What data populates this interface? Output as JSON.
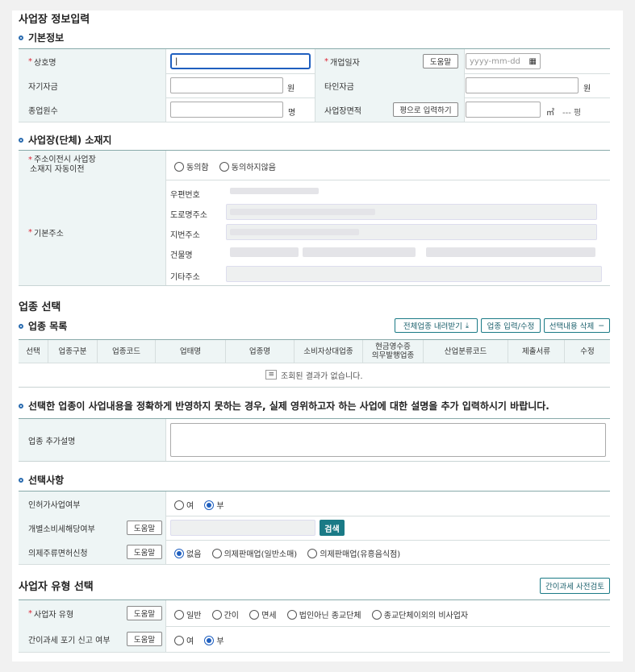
{
  "page_title": "사업장 정보입력",
  "basic": {
    "title": "기본정보",
    "trade_name": "상호명",
    "open_date": "개업일자",
    "help": "도움말",
    "date_placeholder": "yyyy-mm-dd",
    "own_capital": "자기자금",
    "other_capital": "타인자금",
    "won": "원",
    "employees": "종업원수",
    "person_unit": "명",
    "area": "사업장면적",
    "pyeong_input_btn": "평으로 입력하기",
    "m2": "㎡",
    "pyeong_value": "--- 평"
  },
  "location": {
    "title": "사업장(단체) 소재지",
    "auto_move_label_1": "주소이전시 사업장",
    "auto_move_label_2": "소재지 자동이전",
    "agree": "동의함",
    "disagree": "동의하지않음",
    "basic_address": "기본주소",
    "postal": "우편번호",
    "road": "도로명주소",
    "jibun": "지번주소",
    "building": "건물명",
    "other": "기타주소"
  },
  "industry": {
    "section_title": "업종 선택",
    "list_title": "업종 목록",
    "download_btn": "전체업종 내려받기",
    "edit_btn": "업종 입력/수정",
    "delete_btn": "선택내용 삭제",
    "columns": [
      "선택",
      "업종구분",
      "업종코드",
      "업태명",
      "업종명",
      "소비자상대업종",
      "현금영수증\n의무발행업종",
      "산업분류코드",
      "제출서류",
      "수정"
    ],
    "empty": "조회된 결과가 없습니다."
  },
  "extra": {
    "notice": "선택한 업종이 사업내용을 정확하게 반영하지 못하는 경우, 실제 영위하고자 하는 사업에 대한 설명을 추가 입력하시기 바랍니다.",
    "label": "업종 추가설명"
  },
  "options": {
    "title": "선택사항",
    "license": "인허가사업여부",
    "yes": "여",
    "no": "부",
    "excise": "개별소비세해당여부",
    "help": "도움말",
    "search_btn": "검색",
    "liquor": "의제주류면허신청",
    "liquor_opts": [
      "없음",
      "의제판매업(일반소매)",
      "의제판매업(유흥음식점)"
    ]
  },
  "biztype": {
    "title": "사업자 유형 선택",
    "pre_check_btn": "간이과세 사전검토",
    "type_label": "사업자 유형",
    "help": "도움말",
    "types": [
      "일반",
      "간이",
      "면세",
      "법인아닌 종교단체",
      "종교단체이외의 비사업자"
    ],
    "simple_giveup": "간이과세 포기 신고 여부",
    "yes": "여",
    "no": "부"
  },
  "colors": {
    "accent": "#2b6cb0",
    "label_bg": "#eef5f5",
    "search_btn": "#1a7a86"
  }
}
